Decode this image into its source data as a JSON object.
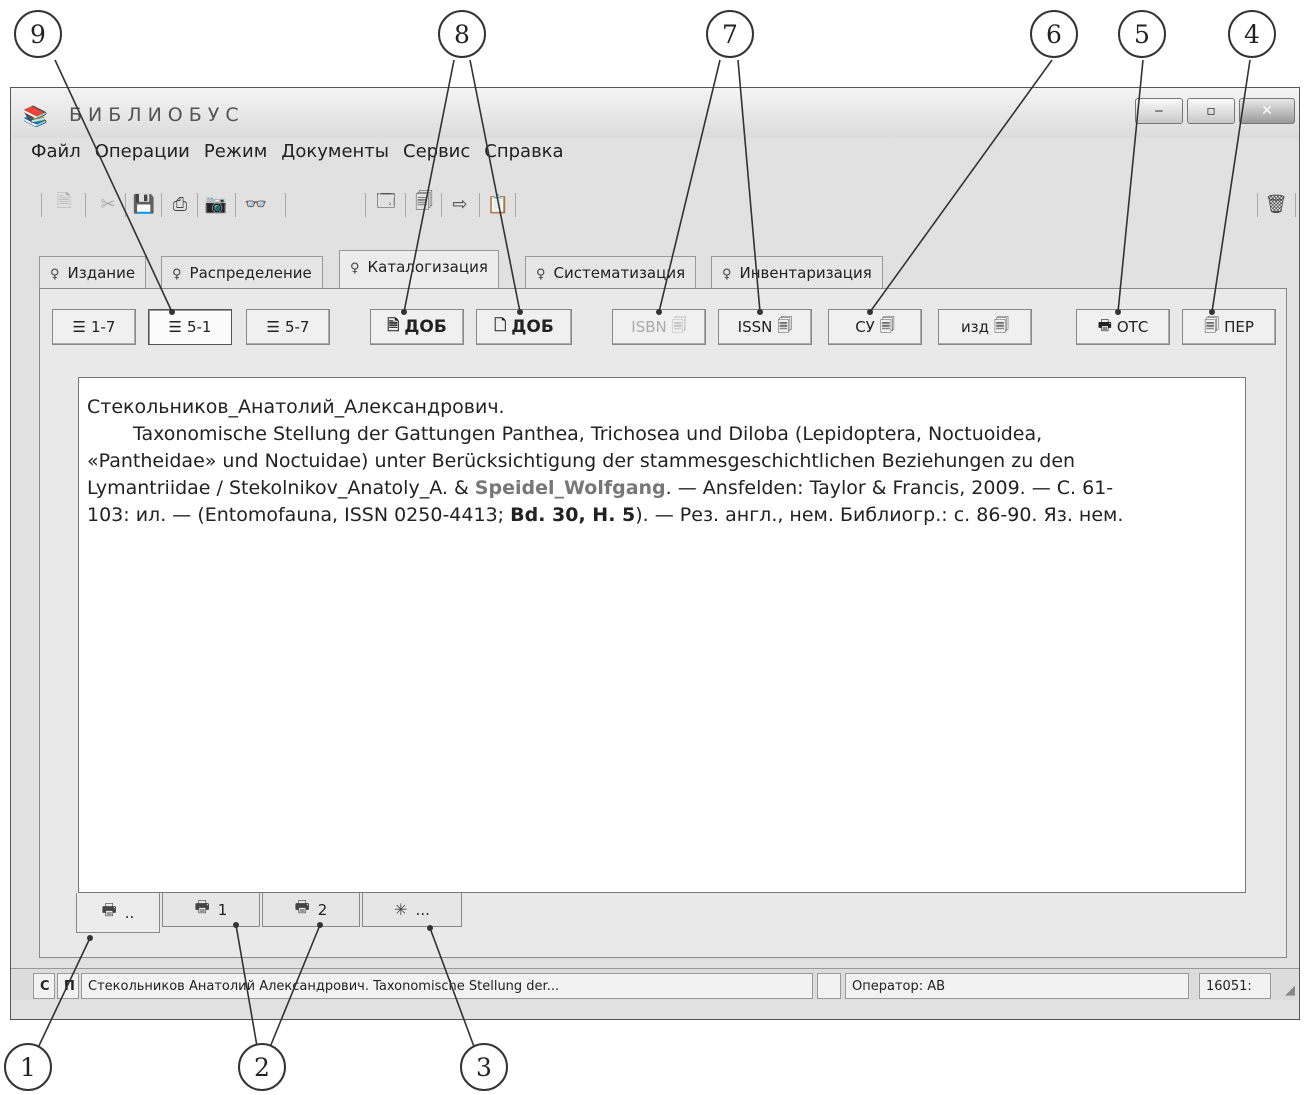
{
  "window": {
    "title": "БИБЛИОБУС",
    "controls": {
      "minimize": "‒",
      "maximize": "▫",
      "close": "✕"
    }
  },
  "menu": [
    "Файл",
    "Операции",
    "Режим",
    "Документы",
    "Сервис",
    "Справка"
  ],
  "toolbar_icons": [
    "new-doc-icon",
    "cut-icon",
    "save-icon",
    "print-icon",
    "camera-icon",
    "binoculars-icon",
    "card-icon",
    "copy-doc-icon",
    "export-icon",
    "clipboard-icon",
    "trash-icon"
  ],
  "tabs": [
    {
      "label": "Издание",
      "active": false
    },
    {
      "label": "Распределение",
      "active": false
    },
    {
      "label": "Каталогизация",
      "active": true
    },
    {
      "label": "Систематизация",
      "active": false
    },
    {
      "label": "Инвентаризация",
      "active": false
    }
  ],
  "buttons": {
    "b17": "1-7",
    "b51": "5-1",
    "b57": "5-7",
    "dob1": "ДОБ",
    "dob2": "ДОБ",
    "isbn": "ISBN",
    "issn": "ISSN",
    "su": "СУ",
    "izd": "изд",
    "ots": "ОТС",
    "per": "ПЕР"
  },
  "record": {
    "line1": "Стекольников_Анатолий_Александрович.",
    "line2": "Taxonomische Stellung der Gattungen Panthea, Trichosea und Diloba (Lepidoptera, Noctuoidea,",
    "line3": "«Pantheidae» und Noctuidae) unter Berücksichtigung der stammesgeschichtlichen Beziehungen zu den",
    "line4a": "Lymantriidae / Stekolnikov_Anatoly_A. & ",
    "line4b": "Speidel_Wolfgang",
    "line4c": ". — Ansfelden: Taylor & Francis, 2009. — С. 61-",
    "line5a": "103: ил. — (Entomofauna, ISSN 0250-4413; ",
    "line5b": "Bd. 30, H. 5",
    "line5c": "). — Рез. англ., нем. Библиогр.: с. 86-90. Яз. нем."
  },
  "bottom_tabs": [
    "..",
    "1",
    "2",
    "..."
  ],
  "status": {
    "c": "С",
    "p": "П",
    "text": "Стекольников Анатолий Александрович. Taxonomische Stellung der...",
    "operator": "Оператор: АВ",
    "number": "16051:"
  },
  "callouts": [
    "1",
    "2",
    "3",
    "4",
    "5",
    "6",
    "7",
    "8",
    "9"
  ]
}
